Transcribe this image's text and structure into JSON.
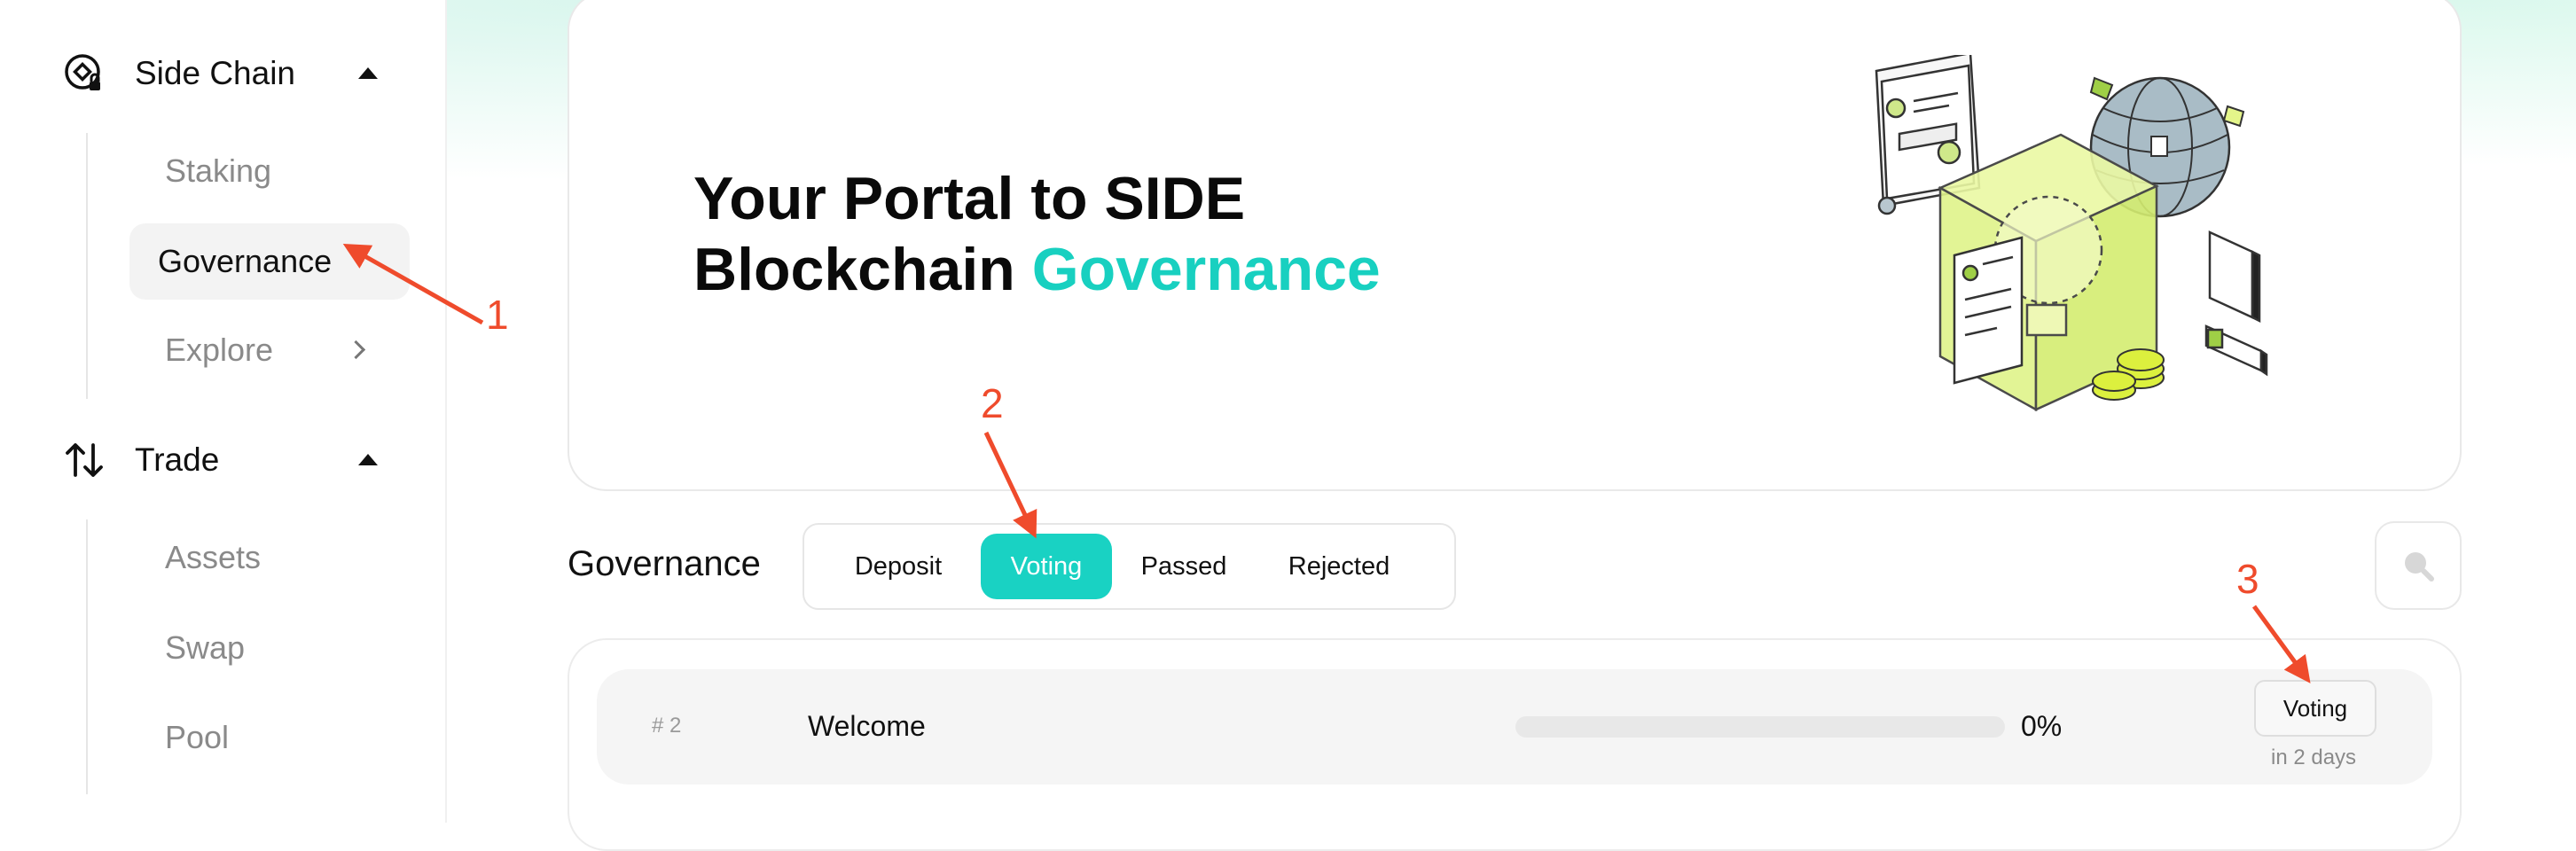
{
  "sidebar": {
    "side_chain": {
      "label": "Side Chain",
      "icon": "side-chain-icon",
      "expanded": true,
      "items": [
        {
          "label": "Staking",
          "active": false
        },
        {
          "label": "Governance",
          "active": true
        },
        {
          "label": "Explore",
          "has_submenu": true
        }
      ]
    },
    "trade": {
      "label": "Trade",
      "icon": "swap-arrows-icon",
      "expanded": true,
      "items": [
        {
          "label": "Assets"
        },
        {
          "label": "Swap"
        },
        {
          "label": "Pool"
        }
      ]
    }
  },
  "hero": {
    "title_line1": "Your Portal to SIDE",
    "title_line2_plain": "Blockchain",
    "title_line2_accent": "Governance",
    "illustration": "isometric-lightbulb-globe-illustration"
  },
  "governance": {
    "title": "Governance",
    "tabs": [
      {
        "label": "Deposit",
        "active": false
      },
      {
        "label": "Voting",
        "active": true
      },
      {
        "label": "Passed",
        "active": false
      },
      {
        "label": "Rejected",
        "active": false
      }
    ],
    "search_icon": "search-icon",
    "proposals": [
      {
        "id": "# 2",
        "title": "Welcome",
        "progress": 0,
        "progress_label": "0%",
        "status": "Voting",
        "time_left": "in 2 days"
      }
    ]
  },
  "annotations": {
    "one": "1",
    "two": "2",
    "three": "3"
  },
  "colors": {
    "accent": "#19d2c3",
    "annotation": "#ef4b2c",
    "illustration_lime": "#e4f58a"
  }
}
